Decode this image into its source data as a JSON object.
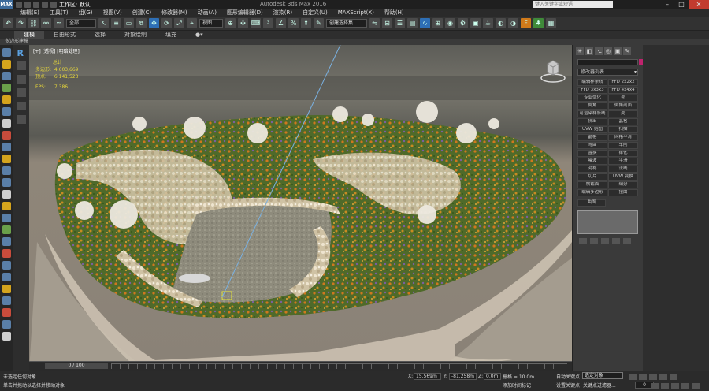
{
  "title_bar": {
    "app_icon": "MAX",
    "workspace_label": "工作区: 默认",
    "title": "Autodesk 3ds Max 2016",
    "search_placeholder": "键入关键字或短语"
  },
  "menu": [
    "编辑(E)",
    "工具(T)",
    "组(G)",
    "视图(V)",
    "创建(C)",
    "修改器(M)",
    "动画(A)",
    "图形编辑器(D)",
    "渲染(R)",
    "自定义(U)",
    "MAXScript(X)",
    "帮助(H)"
  ],
  "toolbar": {
    "filter_value": "全部",
    "view_value": "视图",
    "selection_set_placeholder": "创建选择集"
  },
  "ribbon": {
    "tabs": [
      "建模",
      "自由形式",
      "选择",
      "对象绘制",
      "填充"
    ],
    "subtitle": "多边形建模"
  },
  "viewport": {
    "label": "[+] [透视] [明暗处理]",
    "stats": {
      "total_label": "总计",
      "poly_label": "多边形:",
      "poly_value": "4,603,669",
      "vert_label": "顶点:",
      "vert_value": "6,141,523",
      "fps_label": "FPS:",
      "fps_value": "7.386"
    }
  },
  "command_panel": {
    "modifier_list": "修改器列表",
    "modifiers": [
      "编辑样条线",
      "FFD 2x2x2",
      "FFD 3x3x3",
      "FFD 4x4x4",
      "专业优化",
      "壳",
      "倒角",
      "倒角剖面",
      "可渲染样条线",
      "壳",
      "挤出",
      "晶格",
      "UVW 贴图",
      "扫描",
      "晶格",
      "网格平滑",
      "弯曲",
      "车削",
      "置换",
      "锥化",
      "噪波",
      "平滑",
      "对称",
      "法线",
      "切片",
      "UVW 变换",
      "横截面",
      "细分",
      "编辑多边形",
      "扭曲"
    ],
    "extra_button": "曲面",
    "colors": {
      "object_color": "#c0236e"
    }
  },
  "timeline": {
    "frame_range": "0 / 100"
  },
  "status": {
    "line1": "未选定任何对象",
    "line2": "单击并拖动以选择并移动对象",
    "x_label": "X:",
    "x_value": "15.569m",
    "y_label": "Y:",
    "y_value": "-81.258m",
    "z_label": "Z:",
    "z_value": "0.0m",
    "grid": "栅格 = 10.0m",
    "add_time_tag": "添加时间标记",
    "auto_key": "自动关键点",
    "selection_sets": "选定对象",
    "set_key": "设置关键点",
    "key_filters": "关键点过滤器...",
    "frame_value": "0"
  }
}
